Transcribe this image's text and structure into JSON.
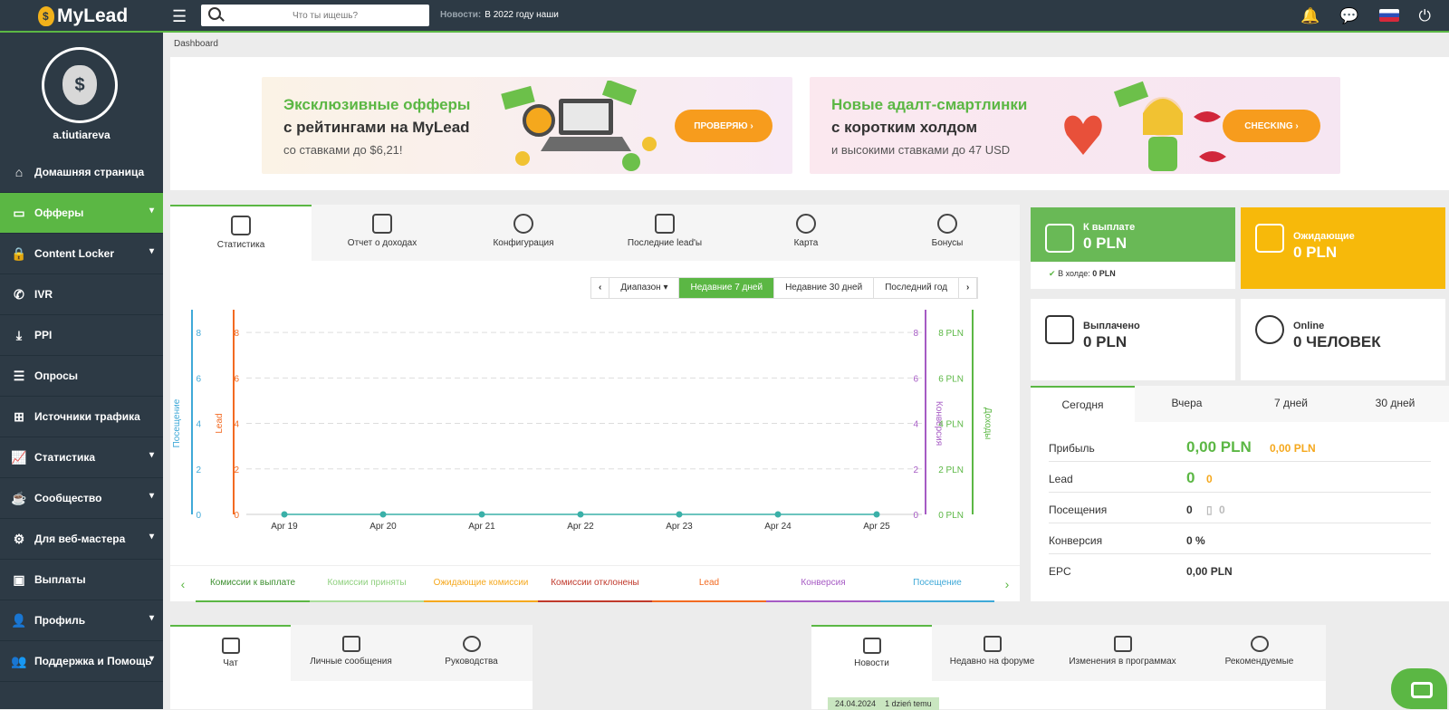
{
  "app": {
    "logo": "MyLead"
  },
  "topbar": {
    "search_placeholder": "Что ты ищешь?",
    "news_label": "Новости:",
    "news_text": "В 2022 году наши"
  },
  "user": {
    "name": "a.tiutiareva"
  },
  "sidebar": {
    "items": [
      {
        "label": "Домашняя страница",
        "icon": "home-icon"
      },
      {
        "label": "Офферы",
        "icon": "monitor-icon"
      },
      {
        "label": "Content Locker",
        "icon": "lock-icon"
      },
      {
        "label": "IVR",
        "icon": "phone-icon"
      },
      {
        "label": "PPI",
        "icon": "download-icon"
      },
      {
        "label": "Опросы",
        "icon": "list-icon"
      },
      {
        "label": "Источники трафика",
        "icon": "sitemap-icon"
      },
      {
        "label": "Статистика",
        "icon": "chart-icon"
      },
      {
        "label": "Сообщество",
        "icon": "coffee-icon"
      },
      {
        "label": "Для веб-мастера",
        "icon": "gears-icon"
      },
      {
        "label": "Выплаты",
        "icon": "money-icon"
      },
      {
        "label": "Профиль",
        "icon": "user-icon"
      },
      {
        "label": "Поддержка и Помощь",
        "icon": "users-icon"
      }
    ]
  },
  "breadcrumb": "Dashboard",
  "banners": [
    {
      "line1": "Эксклюзивные офферы",
      "line2": "с рейтингами на MyLead",
      "sub": "со ставками до $6,21!",
      "button": "ПРОВЕРЯЮ  ›"
    },
    {
      "line1": "Новые адалт-смартлинки",
      "line2": "с коротким холдом",
      "sub": "и высокими ставками до 47 USD",
      "button": "CHECKING  ›"
    }
  ],
  "main_tabs": [
    "Статистика",
    "Отчет о доходах",
    "Конфигурация",
    "Последние lead'ы",
    "Карта",
    "Бонусы"
  ],
  "range": {
    "prev": "‹",
    "dropdown": "Диапазон ▾",
    "options": [
      "Недавние 7 дней",
      "Недавние 30 дней",
      "Последний год"
    ],
    "next": "›"
  },
  "chart_data": {
    "type": "line",
    "categories": [
      "Apr 19",
      "Apr 20",
      "Apr 21",
      "Apr 22",
      "Apr 23",
      "Apr 24",
      "Apr 25"
    ],
    "left_axes": [
      {
        "label": "Посещение",
        "ticks": [
          "0",
          "2",
          "4",
          "6",
          "8"
        ],
        "color": "#3fa9d8"
      },
      {
        "label": "Lead",
        "ticks": [
          "0",
          "2",
          "4",
          "6",
          "8"
        ],
        "color": "#f26a21"
      }
    ],
    "right_axes": [
      {
        "label": "Конверсия",
        "ticks": [
          "0",
          "2",
          "4",
          "6",
          "8"
        ],
        "color": "#a65bc4"
      },
      {
        "label": "Доходы",
        "ticks": [
          "0 PLN",
          "2 PLN",
          "4 PLN",
          "6 PLN",
          "8 PLN"
        ],
        "color": "#5bb744"
      }
    ],
    "ylim": [
      0,
      9
    ],
    "series": [
      {
        "values": [
          0,
          0,
          0,
          0,
          0,
          0,
          0
        ],
        "color": "#3ab0a8"
      }
    ],
    "grid": true
  },
  "legend": {
    "items": [
      {
        "label": "Комиссии к выплате",
        "color": "#3c8f2f",
        "line": "#5bb744"
      },
      {
        "label": "Комиссии приняты",
        "color": "#8fd07f",
        "line": "#a9dd9b"
      },
      {
        "label": "Ожидающие комиссии",
        "color": "#f5a81d",
        "line": "#f5a81d"
      },
      {
        "label": "Комиссии отклонены",
        "color": "#c0392b",
        "line": "#c0392b"
      },
      {
        "label": "Lead",
        "color": "#f26a21",
        "line": "#f26a21"
      },
      {
        "label": "Конверсия",
        "color": "#a65bc4",
        "line": "#a65bc4"
      },
      {
        "label": "Посещение",
        "color": "#3fa9d8",
        "line": "#3fa9d8"
      }
    ]
  },
  "cards": {
    "payout": {
      "title": "К выплате",
      "value": "0 PLN",
      "hold_label": "В холде:",
      "hold_value": "0 PLN"
    },
    "pending": {
      "title": "Ожидающие",
      "value": "0 PLN"
    },
    "paid": {
      "title": "Выплачено",
      "value": "0 PLN"
    },
    "online": {
      "title": "Online",
      "value": "0 ЧЕЛОВЕК"
    }
  },
  "stats": {
    "tabs": [
      "Сегодня",
      "Вчера",
      "7 дней",
      "30 дней"
    ],
    "rows": [
      {
        "key": "Прибыль",
        "value": "0,00 PLN",
        "extra": "0,00 PLN"
      },
      {
        "key": "Lead",
        "value": "0",
        "extra": "0"
      },
      {
        "key": "Посещения",
        "value": "0",
        "extra": "0"
      },
      {
        "key": "Конверсия",
        "value": "0 %"
      },
      {
        "key": "EPC",
        "value": "0,00 PLN"
      }
    ]
  },
  "bottom_left_tabs": [
    "Чат",
    "Личные сообщения",
    "Руководства"
  ],
  "bottom_right_tabs": [
    "Новости",
    "Недавно на форуме",
    "Изменения в программах",
    "Рекомендуемые"
  ],
  "news_date": "24.04.2024",
  "news_ago": "1 dzień temu"
}
